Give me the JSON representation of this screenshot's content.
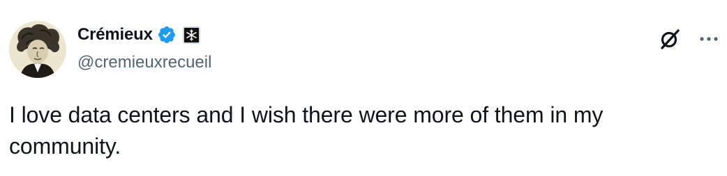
{
  "author": {
    "display_name": "Crémieux",
    "handle": "@cremieuxrecueil",
    "verified": true,
    "verified_color": "#1d9bf0",
    "affiliate_badge_icon": "snowflake-badge-icon",
    "avatar_icon": "portrait-avatar"
  },
  "actions": {
    "grok_icon": "grok-icon",
    "more_icon": "more-horizontal-icon"
  },
  "tweet": {
    "text": "I love data centers and I wish there were more of them in my community."
  },
  "colors": {
    "text_primary": "#0f1419",
    "text_secondary": "#536471",
    "verified_blue": "#1d9bf0",
    "background": "#ffffff"
  }
}
